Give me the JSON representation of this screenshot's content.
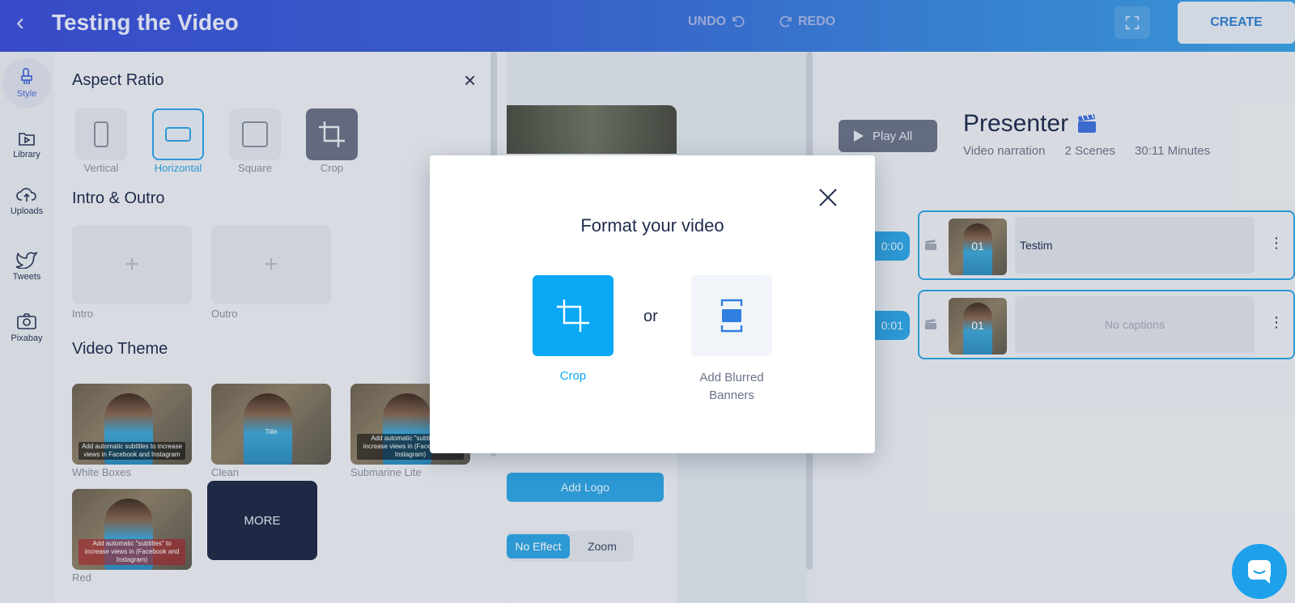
{
  "header": {
    "title": "Testing the Video",
    "undo_label": "UNDO",
    "redo_label": "REDO",
    "create_label": "CREATE"
  },
  "rail": {
    "items": [
      {
        "label": "Style",
        "icon": "brush-icon"
      },
      {
        "label": "Library",
        "icon": "folder-play-icon"
      },
      {
        "label": "Uploads",
        "icon": "cloud-upload-icon"
      },
      {
        "label": "Tweets",
        "icon": "twitter-icon"
      },
      {
        "label": "Pixabay",
        "icon": "camera-icon"
      }
    ]
  },
  "style_panel": {
    "aspect_title": "Aspect Ratio",
    "aspect_options": [
      "Vertical",
      "Horizontal",
      "Square",
      "Crop"
    ],
    "selected_aspect": "Horizontal",
    "intro_outro_title": "Intro & Outro",
    "intro_label": "Intro",
    "outro_label": "Outro",
    "plus": "+",
    "theme_title": "Video Theme",
    "themes": [
      {
        "label": "White Boxes",
        "caption": "Add automatic subtitles to increase views in Facebook and Instagram"
      },
      {
        "label": "Clean",
        "caption": "Title"
      },
      {
        "label": "Submarine Lite",
        "caption": "Add automatic \"subtitles\" to increase views in (Facebook and Instagram)"
      },
      {
        "label": "Red",
        "caption": "Add automatic \"subtitles\" to increase views in (Facebook and Instagram)"
      }
    ],
    "more_label": "MORE"
  },
  "center": {
    "add_logo_label": "Add Logo",
    "no_effect_label": "No Effect",
    "zoom_label": "Zoom"
  },
  "right": {
    "play_all_label": "Play All",
    "presenter_title": "Presenter",
    "meta": [
      "Video narration",
      "2 Scenes",
      "30:11 Minutes"
    ],
    "scenes": [
      {
        "time": "0:00",
        "number": "01",
        "caption": "Testim",
        "empty": false
      },
      {
        "time": "0:01",
        "number": "01",
        "caption": "No captions",
        "empty": true
      }
    ]
  },
  "modal": {
    "title": "Format your video",
    "crop_label": "Crop",
    "or_label": "or",
    "blur_label_line1": "Add Blurred",
    "blur_label_line2": "Banners"
  },
  "colors": {
    "accent": "#0aa8f5",
    "header_start": "#3c4fd8",
    "header_end": "#3ba3e6",
    "dark_text": "#1f2b4d"
  }
}
